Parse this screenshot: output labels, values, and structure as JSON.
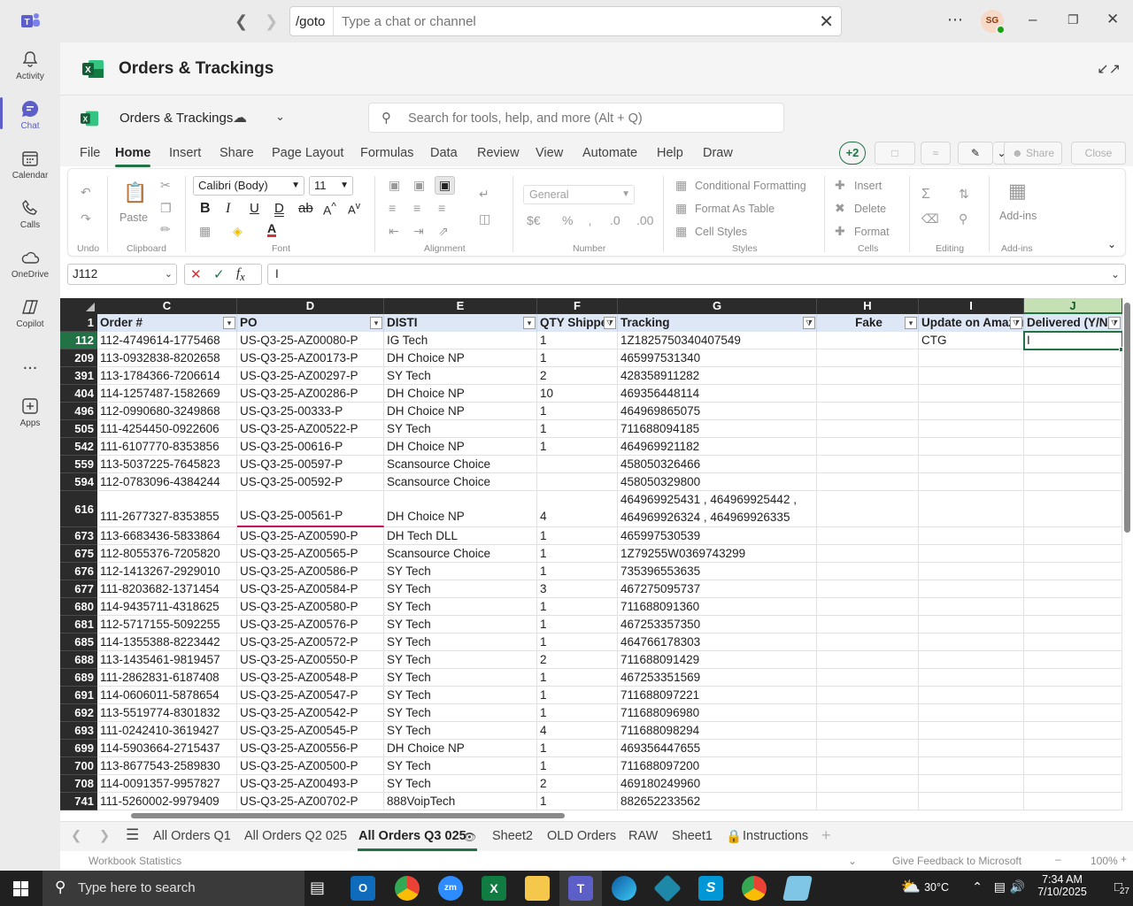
{
  "teams": {
    "command_prefix": "/goto",
    "command_placeholder": "Type a chat or channel",
    "avatar_initials": "SG",
    "rail": [
      {
        "label": "Activity"
      },
      {
        "label": "Chat"
      },
      {
        "label": "Calendar"
      },
      {
        "label": "Calls"
      },
      {
        "label": "OneDrive"
      },
      {
        "label": "Copilot"
      },
      {
        "label": "..."
      },
      {
        "label": "Apps"
      }
    ]
  },
  "excel": {
    "doc_title": "Orders & Trackings",
    "workbook_name": "Orders & Trackings",
    "search_placeholder": "Search for tools, help, and more (Alt + Q)",
    "menu": [
      "File",
      "Home",
      "Insert",
      "Share",
      "Page Layout",
      "Formulas",
      "Data",
      "Review",
      "View",
      "Automate",
      "Help",
      "Draw"
    ],
    "collab_count": "+2",
    "share_label": "Share",
    "close_label": "Close",
    "ribbon": {
      "undo_label": "Undo",
      "paste_label": "Paste",
      "clipboard_label": "Clipboard",
      "font_name": "Calibri (Body)",
      "font_size": "11",
      "font_label": "Font",
      "alignment_label": "Alignment",
      "number_format": "General",
      "number_label": "Number",
      "conditional_formatting": "Conditional Formatting",
      "format_as_table": "Format As Table",
      "cell_styles": "Cell Styles",
      "styles_label": "Styles",
      "insert_label": "Insert",
      "delete_label": "Delete",
      "format_label": "Format",
      "cells_label": "Cells",
      "editing_label": "Editing",
      "addins_label": "Add-ins",
      "addins_group_label": "Add-ins"
    },
    "name_box": "J112",
    "formula_value": "I",
    "columns": [
      "C",
      "D",
      "E",
      "F",
      "G",
      "H",
      "I",
      "J"
    ],
    "headers": [
      "Order #",
      "PO",
      "DISTI",
      "QTY Shipped",
      "Tracking",
      "Fake",
      "Update on Amazon",
      "Delivered (Y/N)"
    ],
    "header_row_num": "1",
    "rows": [
      {
        "n": "112",
        "c": "112-4749614-1775468",
        "d": "US-Q3-25-AZ00080-P",
        "e": "IG Tech",
        "f": "1",
        "g": "1Z1825750340407549",
        "h": "",
        "i": "CTG",
        "j": "I"
      },
      {
        "n": "209",
        "c": "113-0932838-8202658",
        "d": "US-Q3-25-AZ00173-P",
        "e": "DH Choice NP",
        "f": "1",
        "g": "465997531340",
        "h": "",
        "i": "",
        "j": ""
      },
      {
        "n": "391",
        "c": "113-1784366-7206614",
        "d": "US-Q3-25-AZ00297-P",
        "e": "SY Tech",
        "f": "2",
        "g": "428358911282",
        "h": "",
        "i": "",
        "j": ""
      },
      {
        "n": "404",
        "c": "114-1257487-1582669",
        "d": "US-Q3-25-AZ00286-P",
        "e": "DH Choice NP",
        "f": "10",
        "g": "469356448114",
        "h": "",
        "i": "",
        "j": ""
      },
      {
        "n": "496",
        "c": "112-0990680-3249868",
        "d": "US-Q3-25-00333-P",
        "e": "DH Choice NP",
        "f": "1",
        "g": "464969865075",
        "h": "",
        "i": "",
        "j": ""
      },
      {
        "n": "505",
        "c": "111-4254450-0922606",
        "d": "US-Q3-25-AZ00522-P",
        "e": "SY Tech",
        "f": "1",
        "g": "711688094185",
        "h": "",
        "i": "",
        "j": ""
      },
      {
        "n": "542",
        "c": "111-6107770-8353856",
        "d": "US-Q3-25-00616-P",
        "e": "DH Choice NP",
        "f": "1",
        "g": "464969921182",
        "h": "",
        "i": "",
        "j": ""
      },
      {
        "n": "559",
        "c": "113-5037225-7645823",
        "d": "US-Q3-25-00597-P",
        "e": "Scansource Choice",
        "f": "",
        "g": "458050326466",
        "h": "",
        "i": "",
        "j": ""
      },
      {
        "n": "594",
        "c": "112-0783096-4384244",
        "d": "US-Q3-25-00592-P",
        "e": "Scansource Choice",
        "f": "",
        "g": "458050329800",
        "h": "",
        "i": "",
        "j": ""
      },
      {
        "n": "616",
        "c": "111-2677327-8353855",
        "d": "US-Q3-25-00561-P",
        "e": "DH Choice NP",
        "f": "4",
        "g": "464969925431 , 464969925442 ,",
        "g2": "464969926324 , 464969926335",
        "h": "",
        "i": "",
        "j": "",
        "tall": true
      },
      {
        "n": "673",
        "c": "113-6683436-5833864",
        "d": "US-Q3-25-AZ00590-P",
        "e": "DH Tech DLL",
        "f": "1",
        "g": "465997530539",
        "h": "",
        "i": "",
        "j": ""
      },
      {
        "n": "675",
        "c": "112-8055376-7205820",
        "d": "US-Q3-25-AZ00565-P",
        "e": "Scansource Choice",
        "f": "1",
        "g": "1Z79255W0369743299",
        "h": "",
        "i": "",
        "j": ""
      },
      {
        "n": "676",
        "c": "112-1413267-2929010",
        "d": "US-Q3-25-AZ00586-P",
        "e": "SY Tech",
        "f": "1",
        "g": "735396553635",
        "h": "",
        "i": "",
        "j": ""
      },
      {
        "n": "677",
        "c": "111-8203682-1371454",
        "d": "US-Q3-25-AZ00584-P",
        "e": "SY Tech",
        "f": "3",
        "g": "467275095737",
        "h": "",
        "i": "",
        "j": ""
      },
      {
        "n": "680",
        "c": "114-9435711-4318625",
        "d": "US-Q3-25-AZ00580-P",
        "e": "SY Tech",
        "f": "1",
        "g": "711688091360",
        "h": "",
        "i": "",
        "j": ""
      },
      {
        "n": "681",
        "c": "112-5717155-5092255",
        "d": "US-Q3-25-AZ00576-P",
        "e": "SY Tech",
        "f": "1",
        "g": "467253357350",
        "h": "",
        "i": "",
        "j": ""
      },
      {
        "n": "685",
        "c": "114-1355388-8223442",
        "d": "US-Q3-25-AZ00572-P",
        "e": "SY Tech",
        "f": "1",
        "g": "464766178303",
        "h": "",
        "i": "",
        "j": ""
      },
      {
        "n": "688",
        "c": "113-1435461-9819457",
        "d": "US-Q3-25-AZ00550-P",
        "e": "SY Tech",
        "f": "2",
        "g": "711688091429",
        "h": "",
        "i": "",
        "j": ""
      },
      {
        "n": "689",
        "c": "111-2862831-6187408",
        "d": "US-Q3-25-AZ00548-P",
        "e": "SY Tech",
        "f": "1",
        "g": "467253351569",
        "h": "",
        "i": "",
        "j": ""
      },
      {
        "n": "691",
        "c": "114-0606011-5878654",
        "d": "US-Q3-25-AZ00547-P",
        "e": "SY Tech",
        "f": "1",
        "g": "711688097221",
        "h": "",
        "i": "",
        "j": ""
      },
      {
        "n": "692",
        "c": "113-5519774-8301832",
        "d": "US-Q3-25-AZ00542-P",
        "e": "SY Tech",
        "f": "1",
        "g": "711688096980",
        "h": "",
        "i": "",
        "j": ""
      },
      {
        "n": "693",
        "c": "111-0242410-3619427",
        "d": "US-Q3-25-AZ00545-P",
        "e": "SY Tech",
        "f": "4",
        "g": "711688098294",
        "h": "",
        "i": "",
        "j": ""
      },
      {
        "n": "699",
        "c": "114-5903664-2715437",
        "d": "US-Q3-25-AZ00556-P",
        "e": "DH Choice NP",
        "f": "1",
        "g": "469356447655",
        "h": "",
        "i": "",
        "j": ""
      },
      {
        "n": "700",
        "c": "113-8677543-2589830",
        "d": "US-Q3-25-AZ00500-P",
        "e": "SY Tech",
        "f": "1",
        "g": "711688097200",
        "h": "",
        "i": "",
        "j": ""
      },
      {
        "n": "708",
        "c": "114-0091357-9957827",
        "d": "US-Q3-25-AZ00493-P",
        "e": "SY Tech",
        "f": "2",
        "g": "469180249960",
        "h": "",
        "i": "",
        "j": ""
      },
      {
        "n": "741",
        "c": "111-5260002-9979409",
        "d": "US-Q3-25-AZ00702-P",
        "e": "888VoipTech",
        "f": "1",
        "g": "882652233562",
        "h": "",
        "i": "",
        "j": ""
      }
    ],
    "sheet_tabs": [
      "All Orders Q1",
      "All Orders Q2 025",
      "All Orders Q3 025",
      "Sheet2",
      "OLD Orders",
      "RAW",
      "Sheet1",
      "Instructions"
    ],
    "active_sheet": "All Orders Q3 025",
    "status_left": "Workbook Statistics",
    "status_feedback": "Give Feedback to Microsoft",
    "zoom": "100%"
  },
  "taskbar": {
    "search_placeholder": "Type here to search",
    "temperature": "30°C",
    "time": "7:34 AM",
    "date": "7/10/2025",
    "notification_count": "27"
  },
  "colors": {
    "excel_green": "#217346",
    "teams_purple": "#5b5fc7",
    "header_fill": "#dde7f5"
  }
}
